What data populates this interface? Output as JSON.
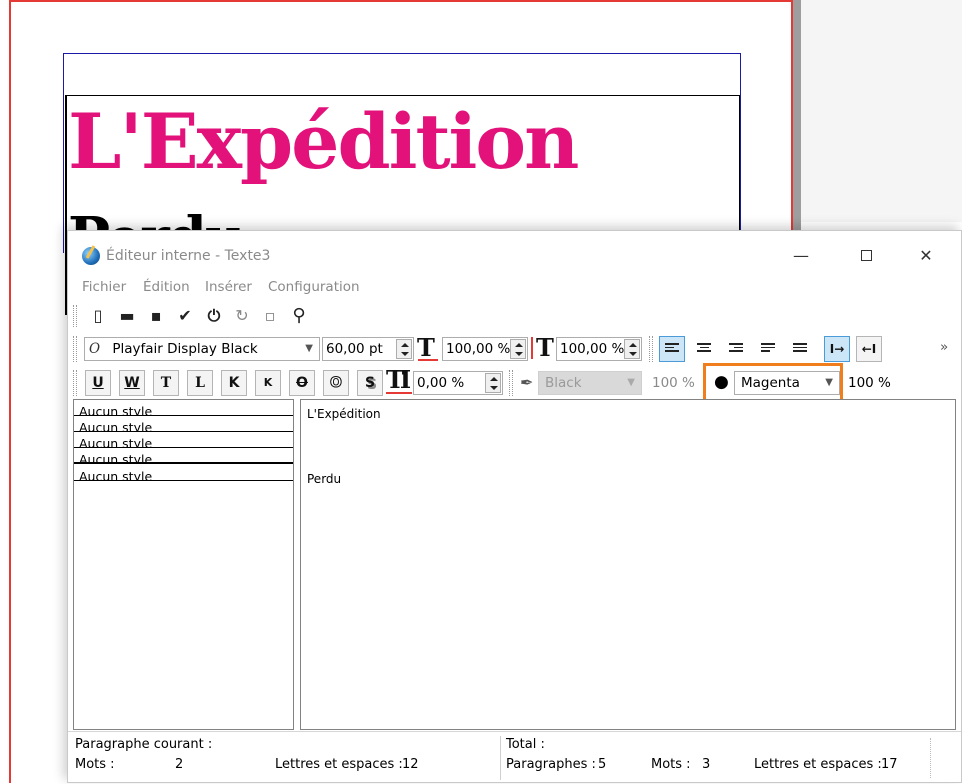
{
  "document": {
    "title": "L'Expédition",
    "subtitle": "Perdu",
    "title_color": "#e2127a"
  },
  "editor": {
    "window_title": "Éditeur interne - Texte3",
    "window_controls": {
      "minimize": "—",
      "maximize": "",
      "close": "✕"
    },
    "menu": [
      "Fichier",
      "Édition",
      "Insérer",
      "Configuration"
    ],
    "toolbar1": [
      {
        "name": "new-document-icon",
        "glyph": "▯"
      },
      {
        "name": "open-folder-icon",
        "glyph": "▬"
      },
      {
        "name": "save-icon",
        "glyph": "▪"
      },
      {
        "name": "checkmark-icon",
        "glyph": "✔"
      },
      {
        "name": "power-icon",
        "glyph": "⏻"
      },
      {
        "name": "reload-icon",
        "glyph": "↻"
      },
      {
        "name": "blank-page-icon",
        "glyph": "▫"
      },
      {
        "name": "search-icon",
        "glyph": "⚲"
      }
    ],
    "font": {
      "family_icon": "O",
      "family": "Playfair Display Black",
      "size": "60,00 pt",
      "scale_horizontal": "100,00 %",
      "scale_vertical": "100,00 %"
    },
    "more_chevron": "»",
    "style_buttons": {
      "underline": "U",
      "underline_words": "W",
      "subscript": "T",
      "superscript": "L",
      "all_caps": "K",
      "small_caps": "K",
      "strike": "O",
      "outline": "O",
      "shadow": "S"
    },
    "tracking": "0,00 %",
    "stroke": {
      "color": "Black",
      "shade": "100 %"
    },
    "fill": {
      "color": "Magenta",
      "shade": "100 %"
    },
    "highlight_color": "#f07e1c",
    "styles": [
      "Aucun style",
      "Aucun style",
      "Aucun style",
      "Aucun style",
      "Aucun style"
    ],
    "paragraphs": [
      "L'Expédition",
      "Perdu"
    ],
    "status": {
      "current_label": "Paragraphe courant :",
      "words_label": "Mots :",
      "words_value": "2",
      "letters_label": "Lettres et espaces :",
      "letters_value": "12",
      "total_label": "Total :",
      "paragraphs_label": "Paragraphes :",
      "paragraphs_value": "5",
      "total_words_label": "Mots :",
      "total_words_value": "3",
      "total_letters_label": "Lettres et espaces :",
      "total_letters_value": "17"
    }
  }
}
